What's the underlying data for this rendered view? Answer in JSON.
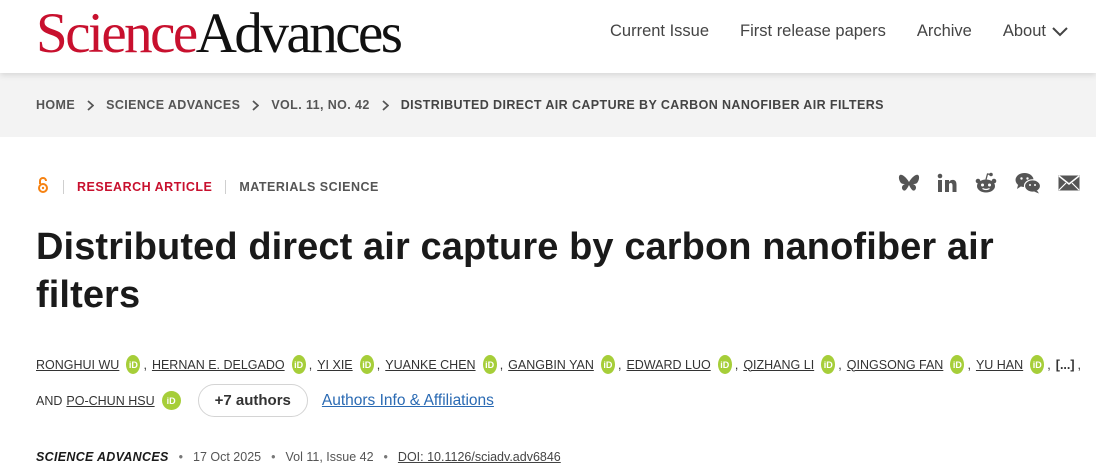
{
  "header": {
    "logo_science": "Science",
    "logo_advances": "Advances",
    "nav": [
      "Current Issue",
      "First release papers",
      "Archive",
      "About"
    ]
  },
  "breadcrumb": [
    "HOME",
    "SCIENCE ADVANCES",
    "VOL. 11, NO. 42",
    "DISTRIBUTED DIRECT AIR CAPTURE BY CARBON NANOFIBER AIR FILTERS"
  ],
  "article": {
    "access_icon": "open-access-icon",
    "type": "RESEARCH ARTICLE",
    "subject": "MATERIALS SCIENCE",
    "title": "Distributed direct air capture by carbon nanofiber air filters",
    "share_icons": [
      "bluesky-icon",
      "linkedin-icon",
      "reddit-icon",
      "wechat-icon",
      "email-icon"
    ]
  },
  "authors": {
    "list": [
      "RONGHUI WU",
      "HERNAN E. DELGADO",
      "YI XIE",
      "YUANKE CHEN",
      "GANGBIN YAN",
      "EDWARD LUO",
      "QIZHANG LI",
      "QINGSONG FAN",
      "YU HAN"
    ],
    "ellipsis": "[...]",
    "and_label": "AND",
    "last_author": "PO-CHUN HSU",
    "orcid_label": "iD",
    "more_button": "+7 authors",
    "affiliations_link": "Authors Info & Affiliations"
  },
  "journal": {
    "name": "SCIENCE ADVANCES",
    "date": "17 Oct 2025",
    "volume": "Vol 11, Issue 42",
    "doi": "DOI: 10.1126/sciadv.adv6846"
  },
  "colors": {
    "brand_red": "#c8102e",
    "orcid_green": "#a6ce39",
    "link_blue": "#2a6ab3"
  }
}
